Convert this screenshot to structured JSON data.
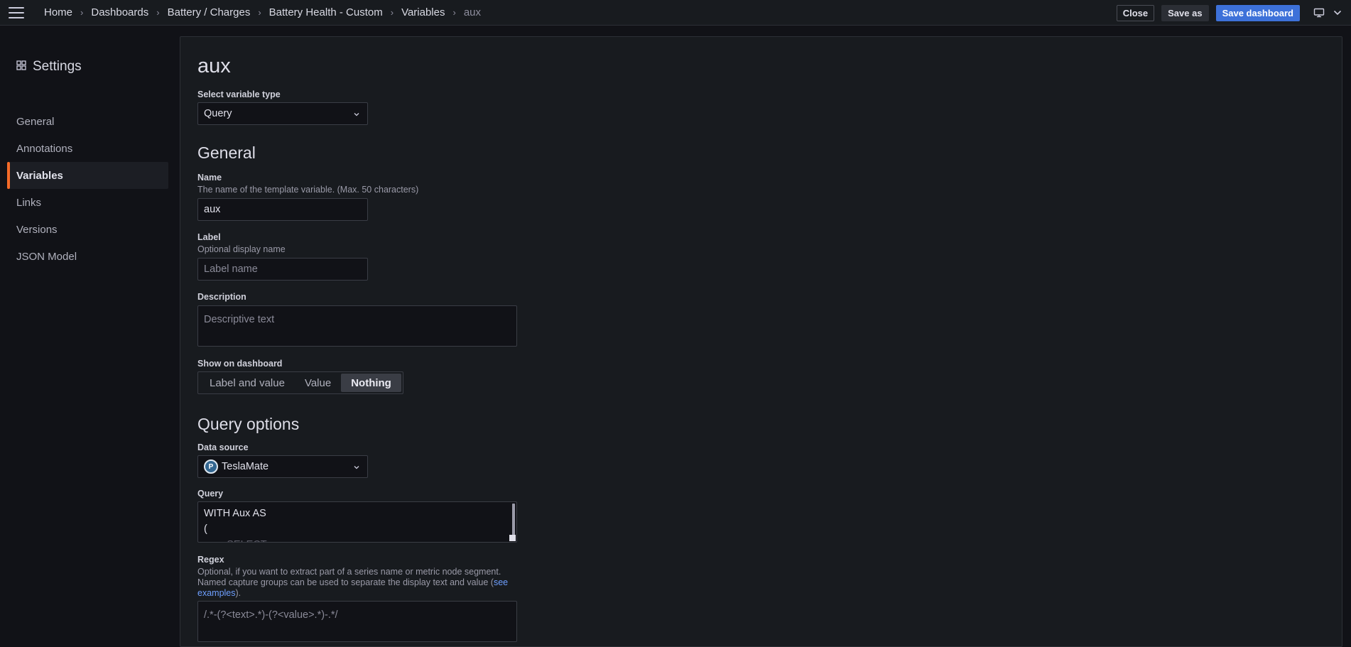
{
  "breadcrumbs": [
    "Home",
    "Dashboards",
    "Battery / Charges",
    "Battery Health - Custom",
    "Variables",
    "aux"
  ],
  "toolbar": {
    "close_label": "Close",
    "save_as_label": "Save as",
    "save_dashboard_label": "Save dashboard"
  },
  "sidebar": {
    "title": "Settings",
    "items": [
      "General",
      "Annotations",
      "Variables",
      "Links",
      "Versions",
      "JSON Model"
    ],
    "active": "Variables"
  },
  "main": {
    "heading": "aux",
    "variable_type": {
      "label": "Select variable type",
      "value": "Query"
    },
    "general": {
      "heading": "General",
      "name": {
        "label": "Name",
        "description": "The name of the template variable. (Max. 50 characters)",
        "value": "aux"
      },
      "label_field": {
        "label": "Label",
        "description": "Optional display name",
        "placeholder": "Label name"
      },
      "description_field": {
        "label": "Description",
        "placeholder": "Descriptive text"
      },
      "show_on_dashboard": {
        "label": "Show on dashboard",
        "options": [
          "Label and value",
          "Value",
          "Nothing"
        ],
        "selected": "Nothing"
      }
    },
    "query_options": {
      "heading": "Query options",
      "data_source": {
        "label": "Data source",
        "value": "TeslaMate"
      },
      "query": {
        "label": "Query",
        "lines": [
          "WITH Aux AS",
          "(",
          "        SELECT"
        ]
      },
      "regex": {
        "label": "Regex",
        "description_1": "Optional, if you want to extract part of a series name or metric node segment.",
        "description_2": "Named capture groups can be used to separate the display text and value (",
        "link_1": "see",
        "link_2": "examples",
        "description_end": ").",
        "value": "/.*-(?<text>.*)-(?<value>.*)-.*/"
      }
    }
  },
  "colors": {
    "accent_primary": "#3d71d9",
    "active_indicator": "#f56b28",
    "link": "#6e9fff"
  },
  "icons": [
    "menu-icon",
    "chevron-right-icon",
    "monitor-icon",
    "chevron-down-icon",
    "settings-grid-icon",
    "postgres-icon"
  ]
}
